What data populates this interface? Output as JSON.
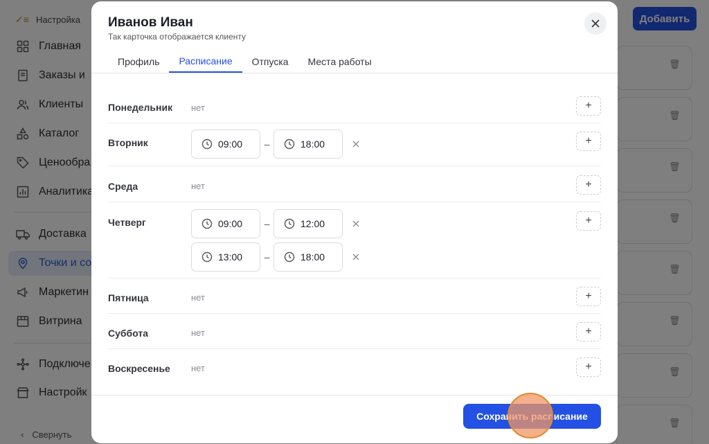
{
  "background": {
    "sidebar": {
      "top_label": "Настройка",
      "items": [
        {
          "label": "Главная",
          "icon": "grid-icon"
        },
        {
          "label": "Заказы и",
          "icon": "receipt-icon"
        },
        {
          "label": "Клиенты",
          "icon": "users-icon"
        },
        {
          "label": "Каталог",
          "icon": "shapes-icon"
        },
        {
          "label": "Ценообра",
          "icon": "tag-icon"
        },
        {
          "label": "Аналитика",
          "icon": "chart-icon"
        },
        {
          "label": "Доставка",
          "icon": "truck-icon"
        },
        {
          "label": "Точки и со",
          "icon": "pin-icon",
          "active": true
        },
        {
          "label": "Маркетин",
          "icon": "megaphone-icon"
        },
        {
          "label": "Витрина",
          "icon": "store-icon"
        },
        {
          "label": "Подключе",
          "icon": "integrations-icon"
        },
        {
          "label": "Настройк",
          "icon": "settings-store-icon"
        }
      ],
      "collapse_label": "Свернуть"
    },
    "add_button_label": "Добавить"
  },
  "modal": {
    "title": "Иванов Иван",
    "subtitle": "Так карточка отображается клиенту",
    "tabs": [
      {
        "label": "Профиль"
      },
      {
        "label": "Расписание",
        "active": true
      },
      {
        "label": "Отпуска"
      },
      {
        "label": "Места работы"
      }
    ],
    "none_label": "нет",
    "days": [
      {
        "name": "Понедельник",
        "slots": []
      },
      {
        "name": "Вторник",
        "slots": [
          {
            "from": "09:00",
            "to": "18:00"
          }
        ]
      },
      {
        "name": "Среда",
        "slots": []
      },
      {
        "name": "Четверг",
        "slots": [
          {
            "from": "09:00",
            "to": "12:00"
          },
          {
            "from": "13:00",
            "to": "18:00"
          }
        ]
      },
      {
        "name": "Пятница",
        "slots": []
      },
      {
        "name": "Суббота",
        "slots": []
      },
      {
        "name": "Воскресенье",
        "slots": []
      }
    ],
    "save_label": "Сохранить расписание"
  },
  "colors": {
    "accent": "#2450e3"
  }
}
